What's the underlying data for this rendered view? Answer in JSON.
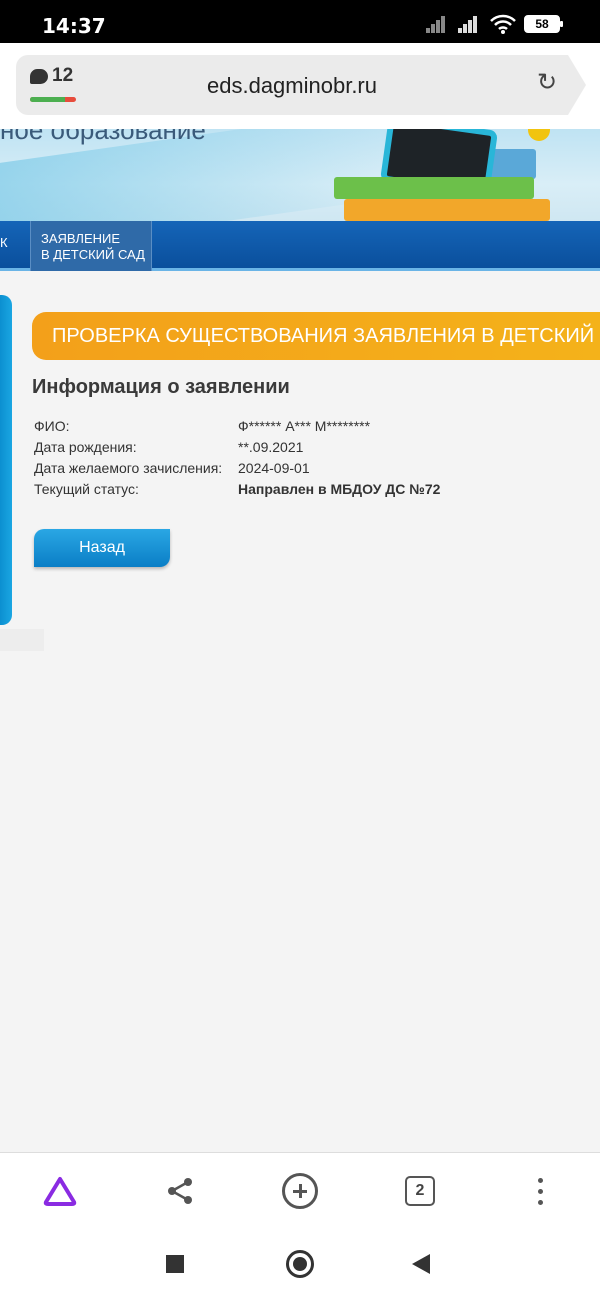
{
  "status_bar": {
    "time": "14:37",
    "battery": "58"
  },
  "browser": {
    "tab_count": "12",
    "load_progress": 0.75,
    "url": "eds.dagminobr.ru",
    "reload_icon": "refresh-icon"
  },
  "banner": {
    "cut_text": "ное образование"
  },
  "nav": {
    "edge_label": "К",
    "item_label_line1": "ЗАЯВЛЕНИЕ",
    "item_label_line2": "В ДЕТСКИЙ САД"
  },
  "section": {
    "header": "ПРОВЕРКА СУЩЕСТВОВАНИЯ ЗАЯВЛЕНИЯ В ДЕТСКИЙ"
  },
  "info": {
    "title": "Информация о заявлении",
    "rows": [
      {
        "label": "ФИО:",
        "value": "Ф****** А*** М********"
      },
      {
        "label": "Дата рождения:",
        "value": "**.09.2021"
      },
      {
        "label": "Дата желаемого зачисления:",
        "value": "2024-09-01"
      },
      {
        "label": "Текущий статус:",
        "value": "Направлен в МБДОУ ДС №72"
      }
    ]
  },
  "buttons": {
    "back": "Назад"
  },
  "toolbar": {
    "tabs_count": "2",
    "icons": [
      "alice-icon",
      "share-icon",
      "add-tab-icon",
      "tabs-icon",
      "more-icon"
    ]
  },
  "colors": {
    "nav_blue": "#0a4f9c",
    "header_orange": "#f3a01a",
    "button_blue": "#0a7ec6",
    "alice_purple": "#8a2be2"
  }
}
